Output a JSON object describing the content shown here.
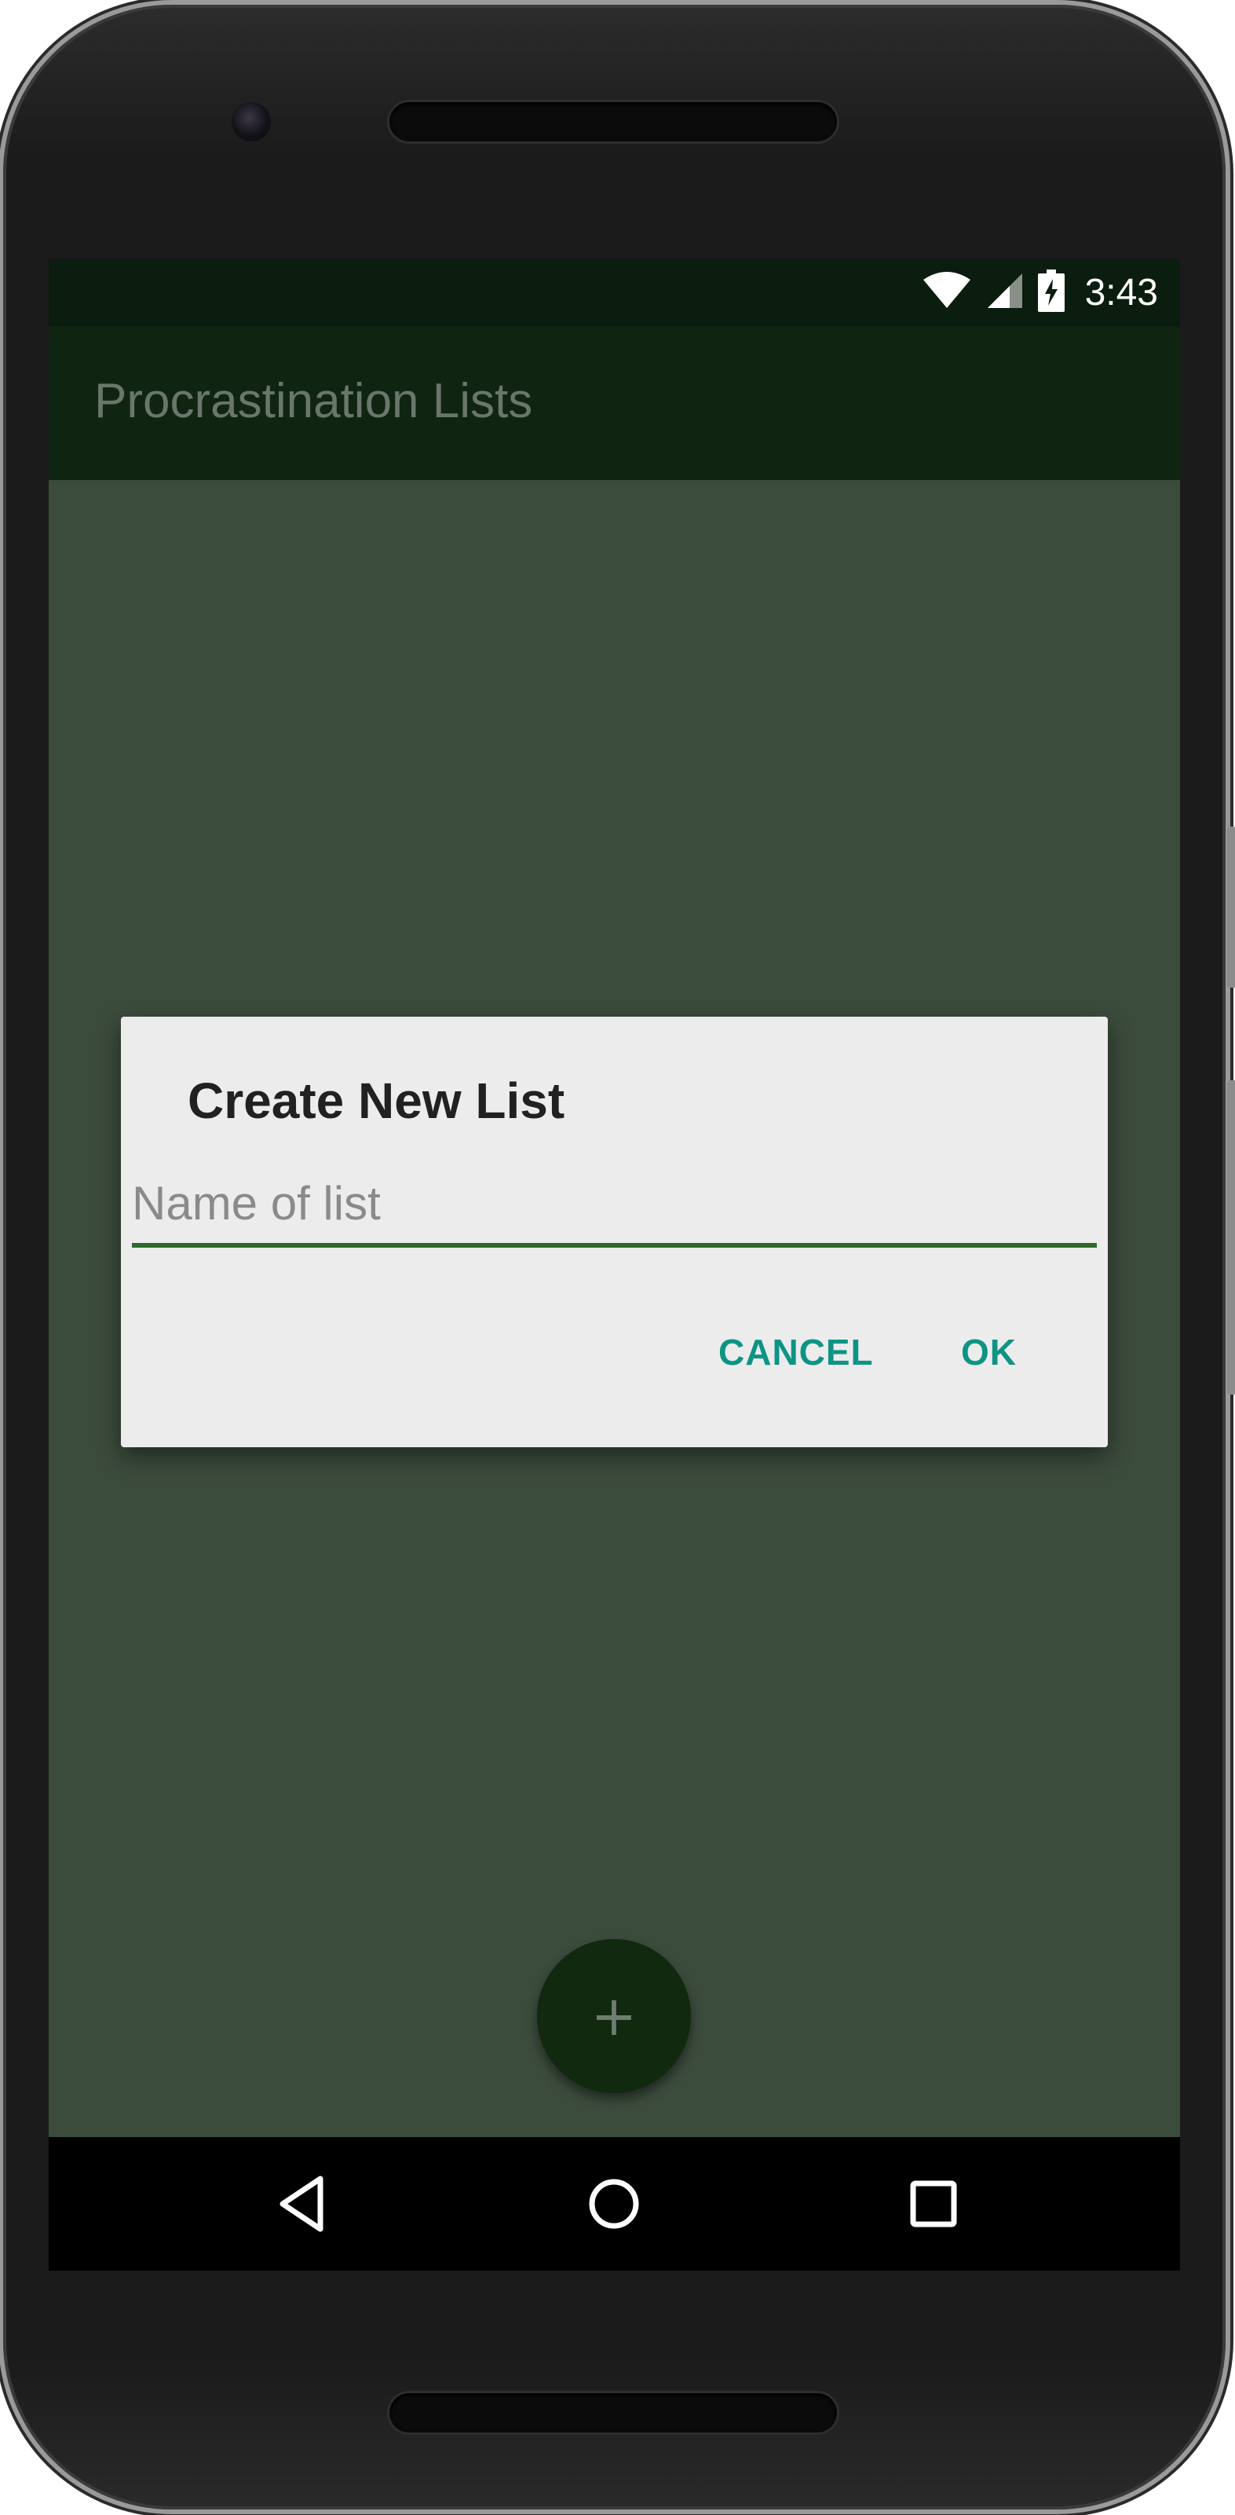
{
  "status_bar": {
    "time": "3:43",
    "icons": [
      "wifi-icon",
      "signal-icon",
      "battery-charging-icon"
    ]
  },
  "app_bar": {
    "title": "Procrastination Lists"
  },
  "dialog": {
    "title": "Create New List",
    "input_value": "",
    "input_placeholder": "Name of list",
    "cancel_label": "CANCEL",
    "ok_label": "OK"
  },
  "fab": {
    "icon": "plus-icon",
    "glyph": "+"
  },
  "nav_bar": {
    "icons": [
      "back-icon",
      "home-icon",
      "recents-icon"
    ]
  },
  "colors": {
    "status_bar": "#0b1d0e",
    "app_bar": "#0f2511",
    "scrim_content": "#3b4b3c",
    "dialog_bg": "#ececec",
    "accent": "#0d9485",
    "input_underline": "#2e6b2a"
  }
}
